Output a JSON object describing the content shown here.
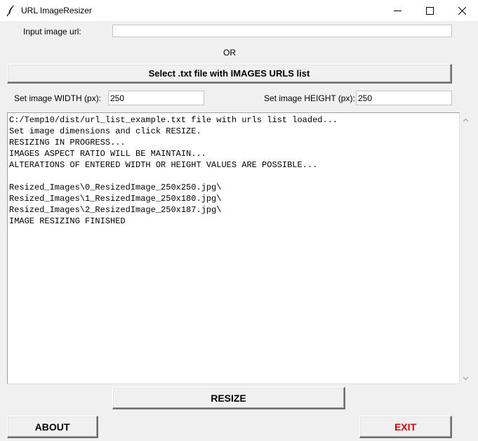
{
  "window": {
    "title": "URL ImageResizer",
    "icon": "feather-icon",
    "controls": [
      "minimize-icon",
      "maximize-icon",
      "close-icon"
    ]
  },
  "url_input": {
    "label": "Input image url:",
    "value": ""
  },
  "or_label": "OR",
  "select_button": {
    "label": "Select .txt file with IMAGES URLS list"
  },
  "width": {
    "label": "Set image WIDTH (px):",
    "value": "250"
  },
  "height": {
    "label": "Set image HEIGHT (px):",
    "value": "250"
  },
  "log": {
    "lines": [
      "C:/Temp10/dist/url_list_example.txt file with urls list loaded...",
      "Set image dimensions and click RESIZE.",
      "RESIZING IN PROGRESS...",
      "IMAGES ASPECT RATIO WILL BE MAINTAIN...",
      "ALTERATIONS OF ENTERED WIDTH OR HEIGHT VALUES ARE POSSIBLE...",
      "",
      "Resized_Images\\0_ResizedImage_250x250.jpg\\",
      "Resized_Images\\1_ResizedImage_250x180.jpg\\",
      "Resized_Images\\2_ResizedImage_250x187.jpg\\",
      "IMAGE RESIZING FINISHED"
    ]
  },
  "resize_button": {
    "label": "RESIZE"
  },
  "about_button": {
    "label": "ABOUT"
  },
  "exit_button": {
    "label": "EXIT",
    "color": "#e00000"
  }
}
